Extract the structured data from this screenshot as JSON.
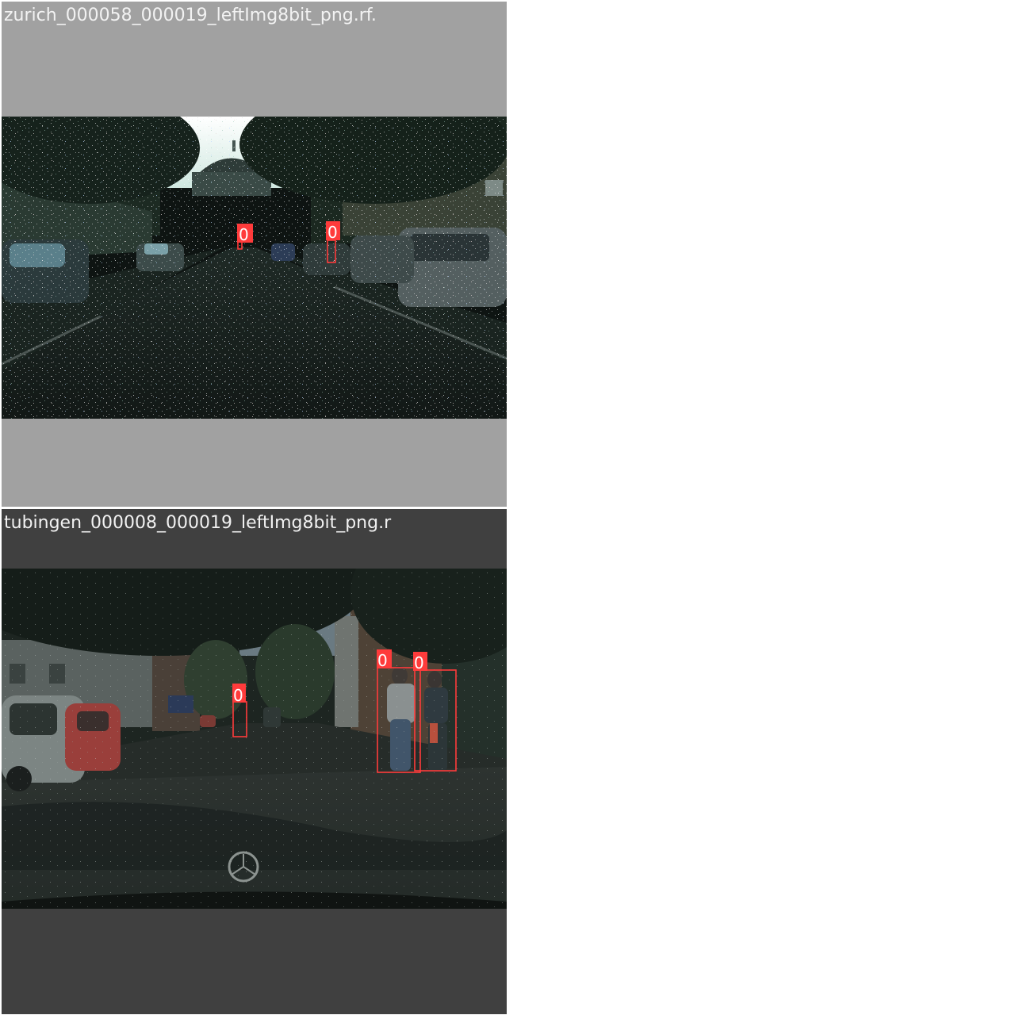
{
  "colors": {
    "box": "#ff3b3b",
    "tile1_background": "#a1a1a1",
    "tile2_background": "#404040",
    "page_background": "#ffffff"
  },
  "tiles": [
    {
      "title": "zurich_000058_000019_leftImg8bit_png.rf.",
      "detections": [
        {
          "label": "0"
        },
        {
          "label": "0"
        }
      ]
    },
    {
      "title": "tubingen_000008_000019_leftImg8bit_png.r",
      "detections": [
        {
          "label": "0"
        },
        {
          "label": "0"
        },
        {
          "label": "0"
        }
      ]
    }
  ]
}
